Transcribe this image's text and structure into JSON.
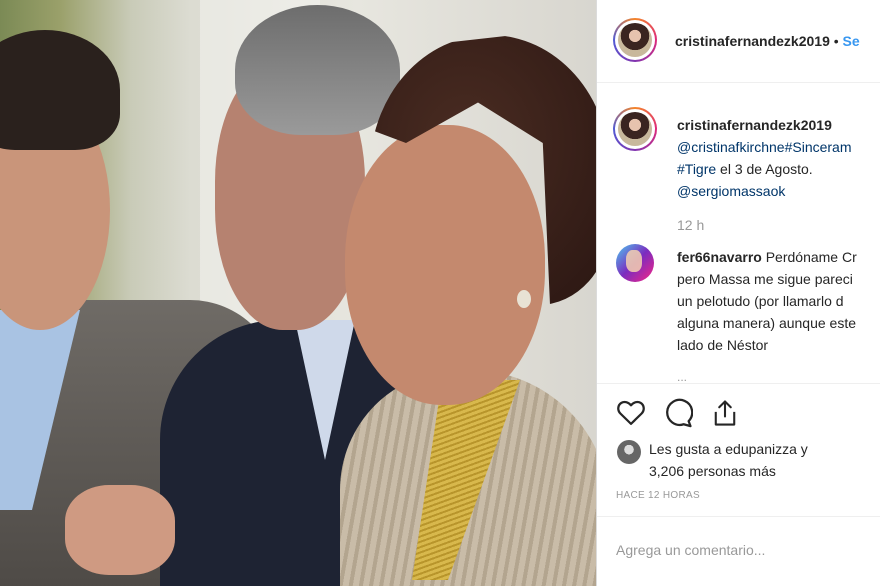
{
  "post": {
    "author": "cristinafernandezk2019",
    "follow_label": "Se",
    "caption": {
      "author": "cristinafernandezk2019",
      "mention1": "@cristinafkirchne",
      "hashtag1": "#Sinceram",
      "hashtag2": "#Tigre",
      "text_after": " el 3 de Agosto.",
      "mention2": "@sergiomassaok"
    },
    "time": "12 h",
    "comment": {
      "author": "fer66navarro",
      "line1": " Perdóname Cr",
      "line2": "pero Massa me sigue pareci",
      "line3": "un pelotudo (por llamarlo d",
      "line4": "alguna manera) aunque este",
      "line5": "lado de Néstor"
    },
    "more": "...",
    "likes_line1": "Les gusta a edupanizza y",
    "likes_line2": "3,206 personas más",
    "ago": "HACE 12 HORAS",
    "comment_placeholder": "Agrega un comentario..."
  },
  "icons": [
    "heart-icon",
    "comment-icon",
    "share-icon"
  ]
}
